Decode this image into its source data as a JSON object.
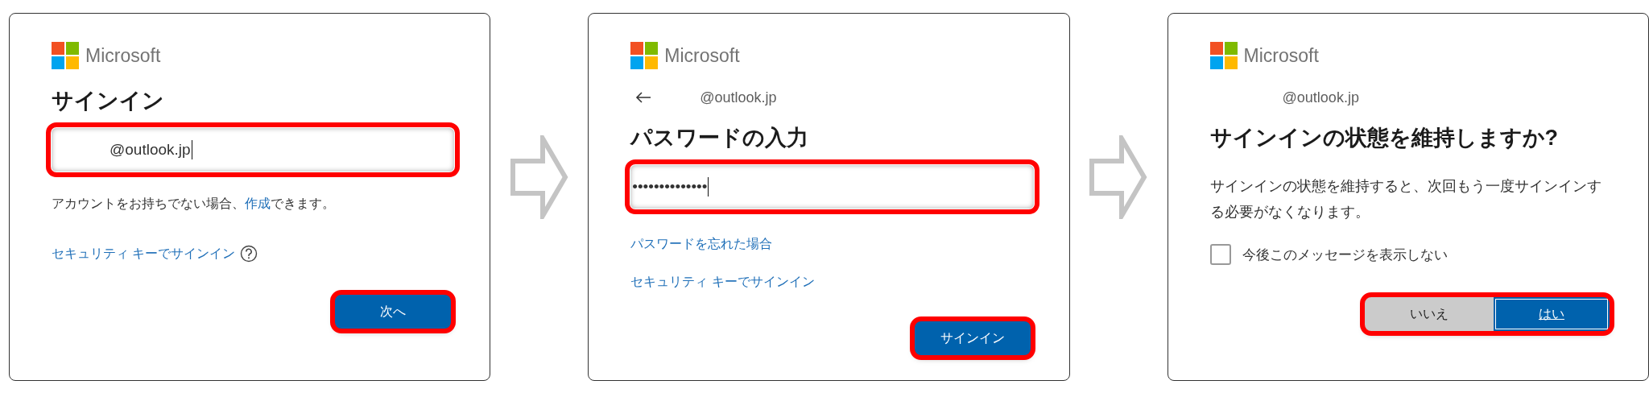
{
  "panels": [
    {
      "brand": "Microsoft",
      "title": "サインイン",
      "field": {
        "value": "@outlook.jp",
        "highlighted": true
      },
      "note": [
        {
          "text": "アカウントをお持ちでない場合、",
          "kind": "text"
        },
        {
          "text": "作成",
          "kind": "link"
        },
        {
          "text": "できます。",
          "kind": "text"
        }
      ],
      "links": [
        {
          "label": "セキュリティ キーでサインイン",
          "help": true
        }
      ],
      "actions": {
        "highlighted": true,
        "buttons": [
          {
            "label": "次へ",
            "kind": "primary",
            "focused": false
          }
        ]
      }
    },
    {
      "brand": "Microsoft",
      "back": true,
      "account": "@outlook.jp",
      "title": "パスワードの入力",
      "field": {
        "value": "••••••••••••••",
        "highlighted": true
      },
      "links": [
        {
          "label": "パスワードを忘れた場合",
          "help": false
        },
        {
          "label": "セキュリティ キーでサインイン",
          "help": false
        }
      ],
      "actions": {
        "highlighted": true,
        "buttons": [
          {
            "label": "サインイン",
            "kind": "primary",
            "focused": false
          }
        ]
      }
    },
    {
      "brand": "Microsoft",
      "account": "@outlook.jp",
      "title": "サインインの状態を維持しますか?",
      "description": "サインインの状態を維持すると、次回もう一度サインインする必要がなくなります。",
      "checkbox": {
        "label": "今後このメッセージを表示しない",
        "checked": false
      },
      "actions": {
        "highlighted": true,
        "buttons": [
          {
            "label": "いいえ",
            "kind": "secondary",
            "focused": false
          },
          {
            "label": "はい",
            "kind": "primary",
            "focused": true
          }
        ]
      }
    }
  ]
}
